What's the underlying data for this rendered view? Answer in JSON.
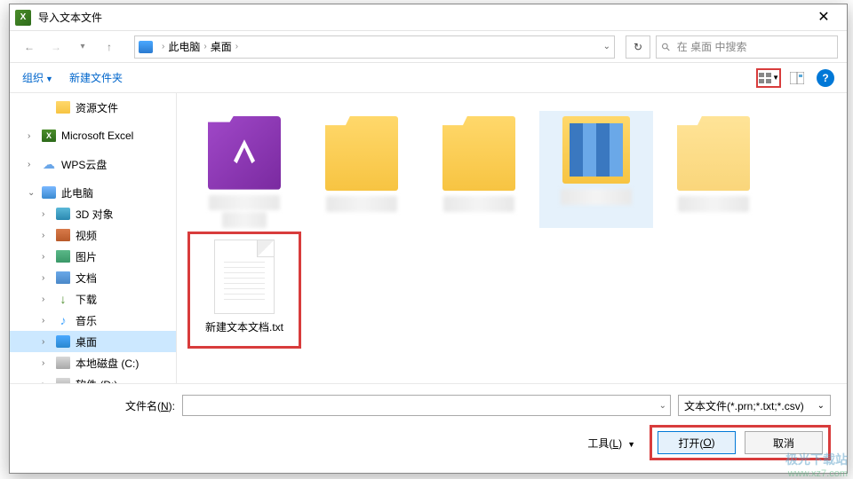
{
  "window": {
    "title": "导入文本文件"
  },
  "nav": {
    "path_root": "此电脑",
    "path_current": "桌面",
    "search_placeholder": "在 桌面 中搜索"
  },
  "toolbar": {
    "organize": "组织",
    "new_folder": "新建文件夹"
  },
  "sidebar": {
    "resource_files": "资源文件",
    "ms_excel": "Microsoft Excel",
    "wps_cloud": "WPS云盘",
    "this_pc": "此电脑",
    "objects_3d": "3D 对象",
    "videos": "视频",
    "pictures": "图片",
    "documents": "文档",
    "downloads": "下载",
    "music": "音乐",
    "desktop": "桌面",
    "local_disk_c": "本地磁盘 (C:)",
    "software_d": "软件 (D:)"
  },
  "files": {
    "txt_name": "新建文本文档.txt"
  },
  "footer": {
    "filename_label_pre": "文件名(",
    "filename_label_key": "N",
    "filename_label_post": "):",
    "filetype": "文本文件(*.prn;*.txt;*.csv)",
    "tools_pre": "工具(",
    "tools_key": "L",
    "tools_post": ")",
    "open_pre": "打开(",
    "open_key": "O",
    "open_post": ")",
    "cancel": "取消"
  },
  "watermark": {
    "line1": "极光下载站",
    "line2": "www.xz7.com"
  }
}
